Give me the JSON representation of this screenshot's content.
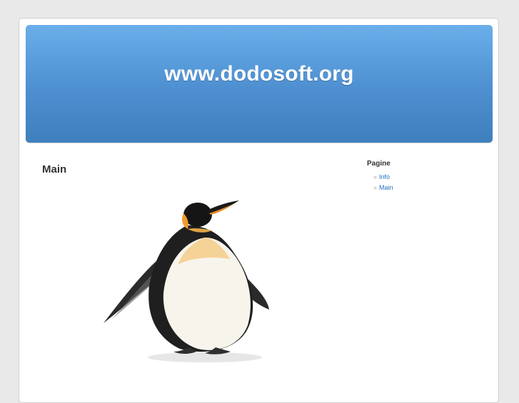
{
  "header": {
    "site_title": "www.dodosoft.org"
  },
  "main": {
    "title": "Main",
    "image_icon": "penguin-image"
  },
  "sidebar": {
    "title": "Pagine",
    "bullet": "»",
    "items": [
      {
        "label": "Info"
      },
      {
        "label": "Main"
      }
    ]
  },
  "colors": {
    "header_top": "#6aaeea",
    "header_bottom": "#3f7fbd",
    "link": "#2a6fc0",
    "background": "#e9e9e9"
  }
}
